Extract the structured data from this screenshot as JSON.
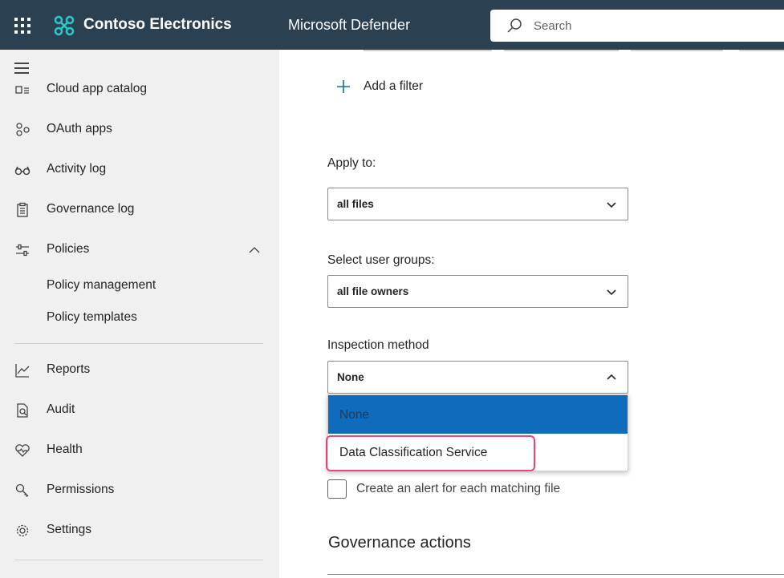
{
  "topbar": {
    "brand_name": "Contoso Electronics",
    "product_name": "Microsoft Defender",
    "search_placeholder": "Search",
    "background_color": "#2b4152",
    "brand_icon_color": "#2ec5c9"
  },
  "sidebar": {
    "items": [
      {
        "label": "Cloud app catalog",
        "icon": "catalog-icon"
      },
      {
        "label": "OAuth apps",
        "icon": "oauth-icon"
      },
      {
        "label": "Activity log",
        "icon": "glasses-icon"
      },
      {
        "label": "Governance log",
        "icon": "clipboard-icon"
      },
      {
        "label": "Policies",
        "icon": "sliders-icon",
        "expanded": true
      },
      {
        "label": "Reports",
        "icon": "chart-line-icon"
      },
      {
        "label": "Audit",
        "icon": "document-search-icon"
      },
      {
        "label": "Health",
        "icon": "heart-pulse-icon"
      },
      {
        "label": "Permissions",
        "icon": "key-icon"
      },
      {
        "label": "Settings",
        "icon": "gear-icon"
      }
    ],
    "policies_children": [
      {
        "label": "Policy management"
      },
      {
        "label": "Policy templates"
      }
    ]
  },
  "main": {
    "add_filter_label": "Add a filter",
    "apply_to": {
      "label": "Apply to:",
      "value": "all files"
    },
    "user_groups": {
      "label": "Select user groups:",
      "value": "all file owners"
    },
    "inspection_method": {
      "label": "Inspection method",
      "value": "None",
      "options": [
        "None",
        "Data Classification Service"
      ],
      "selected_index": 0
    },
    "alert_checkbox": {
      "label": "Create an alert for each matching file",
      "checked": false
    },
    "governance_title": "Governance actions"
  },
  "colors": {
    "accent": "#0f6cbd",
    "highlight": "#e8457a",
    "sidebar_bg": "#f0f0f0"
  }
}
